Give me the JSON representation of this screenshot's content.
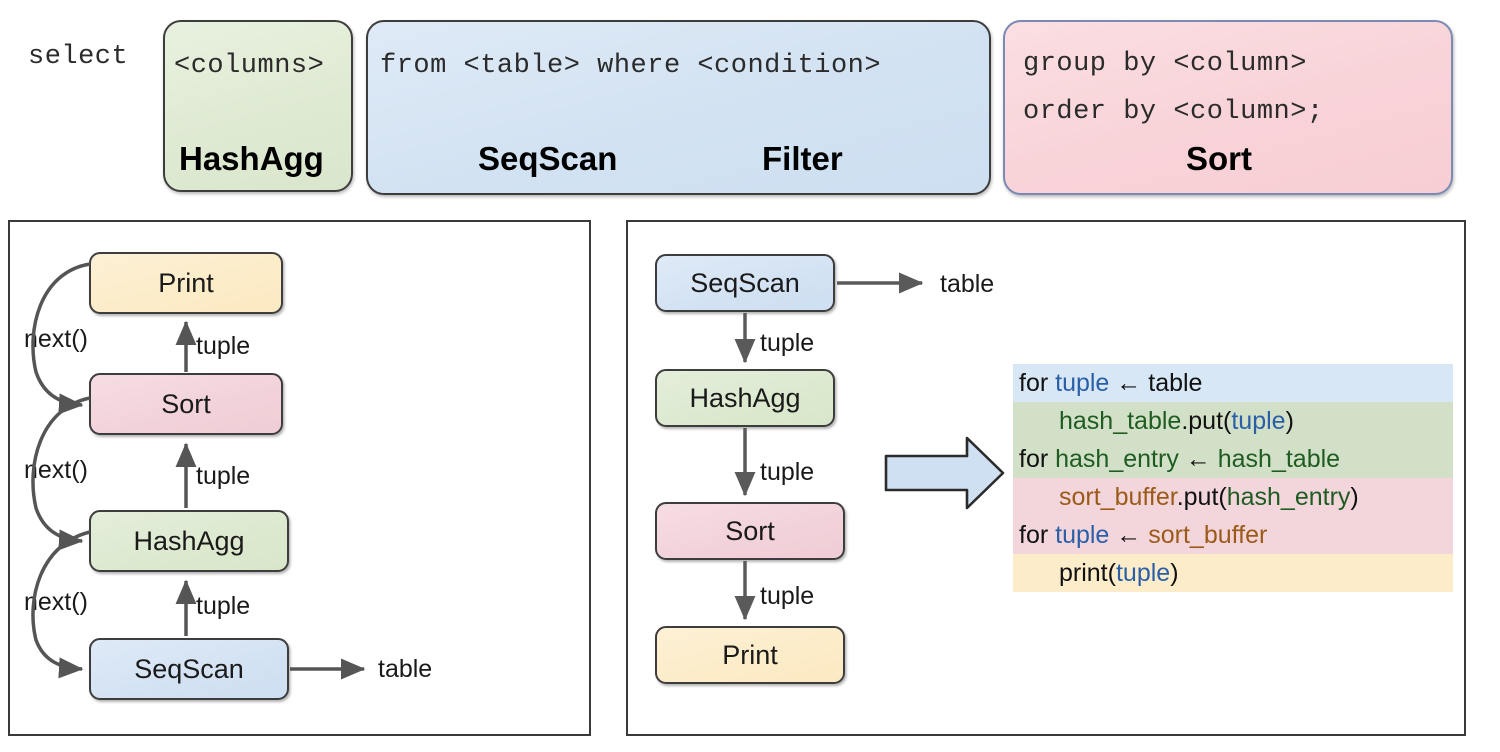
{
  "sql": {
    "prefix": "select",
    "boxes": [
      {
        "id": "hashagg",
        "sql_text": "<columns>",
        "operator": "HashAgg",
        "fill": "#dfead3",
        "stroke": "#3d3d3d"
      },
      {
        "id": "seqscan",
        "sql_text": "from <table> where <condition>",
        "operator": "SeqScan",
        "operator2": "Filter",
        "fill": "#d2e2f2",
        "stroke": "#3d3d3d"
      },
      {
        "id": "sort",
        "sql_text_line1": "group by <column>",
        "sql_text_line2": "order by <column>;",
        "operator": "Sort",
        "fill": "#f8d3d8",
        "stroke": "#7a8ab5"
      }
    ]
  },
  "left_panel": {
    "nodes": [
      {
        "label": "Print",
        "color": "#fcecc8"
      },
      {
        "label": "Sort",
        "color": "#f2d2da"
      },
      {
        "label": "HashAgg",
        "color": "#dce9cf"
      },
      {
        "label": "SeqScan",
        "color": "#d3e2f3"
      }
    ],
    "next_labels": [
      "next()",
      "next()",
      "next()"
    ],
    "tuple_labels": [
      "tuple",
      "tuple",
      "tuple"
    ],
    "table_label": "table"
  },
  "right_panel": {
    "nodes": [
      {
        "label": "SeqScan",
        "color": "#d3e2f3"
      },
      {
        "label": "HashAgg",
        "color": "#dce9cf"
      },
      {
        "label": "Sort",
        "color": "#f2d2da"
      },
      {
        "label": "Print",
        "color": "#fcecc8"
      }
    ],
    "tuple_labels": [
      "tuple",
      "tuple",
      "tuple"
    ],
    "table_label": "table",
    "transform_arrow": "right-arrow-icon"
  },
  "code_block": {
    "lines": [
      {
        "band": "#d7e7f6",
        "indent": 0,
        "tokens": [
          {
            "text": "for ",
            "color": "#111111"
          },
          {
            "text": "tuple",
            "color": "#2a5fa8"
          },
          {
            "text": " ← ",
            "color": "#111111"
          },
          {
            "text": "table",
            "color": "#111111"
          }
        ]
      },
      {
        "band": "#d3e0c8",
        "indent": 1,
        "tokens": [
          {
            "text": "hash_table",
            "color": "#1f5c22"
          },
          {
            "text": ".put(",
            "color": "#111111"
          },
          {
            "text": "tuple",
            "color": "#2a5fa8"
          },
          {
            "text": ")",
            "color": "#111111"
          }
        ]
      },
      {
        "band": "#d3e0c8",
        "indent": 0,
        "tokens": [
          {
            "text": "for ",
            "color": "#111111"
          },
          {
            "text": "hash_entry",
            "color": "#1f5c22"
          },
          {
            "text": " ← ",
            "color": "#111111"
          },
          {
            "text": "hash_table",
            "color": "#1f5c22"
          }
        ]
      },
      {
        "band": "#f3d6dc",
        "indent": 1,
        "tokens": [
          {
            "text": "sort_buffer",
            "color": "#9c5a19"
          },
          {
            "text": ".put(",
            "color": "#111111"
          },
          {
            "text": "hash_entry",
            "color": "#1f5c22"
          },
          {
            "text": ")",
            "color": "#111111"
          }
        ]
      },
      {
        "band": "#f3d6dc",
        "indent": 0,
        "tokens": [
          {
            "text": "for ",
            "color": "#111111"
          },
          {
            "text": "tuple",
            "color": "#2a5fa8"
          },
          {
            "text": " ← ",
            "color": "#111111"
          },
          {
            "text": "sort_buffer",
            "color": "#9c5a19"
          }
        ]
      },
      {
        "band": "#fcecc9",
        "indent": 1,
        "tokens": [
          {
            "text": "print(",
            "color": "#111111"
          },
          {
            "text": "tuple",
            "color": "#2a5fa8"
          },
          {
            "text": ")",
            "color": "#111111"
          }
        ]
      }
    ]
  }
}
